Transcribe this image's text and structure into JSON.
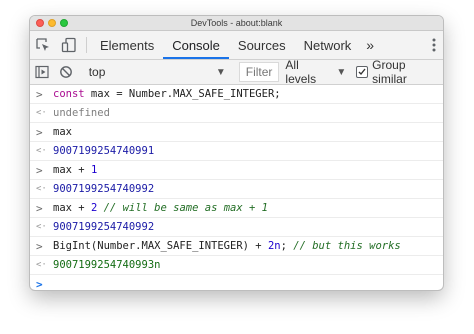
{
  "window": {
    "title": "DevTools - about:blank"
  },
  "tabs": [
    {
      "label": "Elements",
      "active": false
    },
    {
      "label": "Console",
      "active": true
    },
    {
      "label": "Sources",
      "active": false
    },
    {
      "label": "Network",
      "active": false
    }
  ],
  "more_tabs_glyph": "»",
  "toolbar": {
    "context": "top",
    "filter_placeholder": "Filter",
    "levels": "All levels",
    "group_similar": "Group similar",
    "group_similar_checked": true
  },
  "console": {
    "entries": [
      {
        "input": [
          {
            "t": "const",
            "c": "kw"
          },
          {
            "t": " max ",
            "c": "var"
          },
          {
            "t": "=",
            "c": "op"
          },
          {
            "t": " Number.MAX_SAFE_INTEGER;",
            "c": "var"
          }
        ],
        "output": "undefined",
        "output_kind": "undef"
      },
      {
        "input": [
          {
            "t": "max",
            "c": "var"
          }
        ],
        "output": "9007199254740991",
        "output_kind": "num"
      },
      {
        "input": [
          {
            "t": "max ",
            "c": "var"
          },
          {
            "t": "+",
            "c": "op"
          },
          {
            "t": " ",
            "c": "var"
          },
          {
            "t": "1",
            "c": "num"
          }
        ],
        "output": "9007199254740992",
        "output_kind": "num"
      },
      {
        "input": [
          {
            "t": "max ",
            "c": "var"
          },
          {
            "t": "+",
            "c": "op"
          },
          {
            "t": " ",
            "c": "var"
          },
          {
            "t": "2",
            "c": "num"
          },
          {
            "t": " // will be same as max + 1",
            "c": "cmt"
          }
        ],
        "output": "9007199254740992",
        "output_kind": "num"
      },
      {
        "input": [
          {
            "t": "BigInt(Number.MAX_SAFE_INTEGER) ",
            "c": "var"
          },
          {
            "t": "+",
            "c": "op"
          },
          {
            "t": " ",
            "c": "var"
          },
          {
            "t": "2n",
            "c": "num"
          },
          {
            "t": "; ",
            "c": "var"
          },
          {
            "t": "// but this works",
            "c": "cmt"
          }
        ],
        "output": "9007199254740993n",
        "output_kind": "big"
      }
    ]
  },
  "colors": {
    "accent": "#1a73e8",
    "number_output": "#1a1aa6",
    "bigint_output": "#136c13",
    "comment": "#236e25"
  }
}
